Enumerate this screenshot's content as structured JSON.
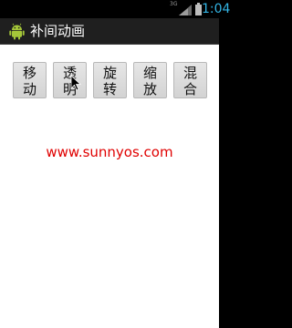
{
  "status_bar": {
    "network_label": "3G",
    "time": "1:04",
    "icons": [
      "signal-icon",
      "battery-icon"
    ],
    "time_color": "#33b5e5"
  },
  "title_bar": {
    "title": "补间动画",
    "icon": "android-icon"
  },
  "buttons": [
    {
      "line1": "移",
      "line2": "动"
    },
    {
      "line1": "透",
      "line2": "明"
    },
    {
      "line1": "旋",
      "line2": "转"
    },
    {
      "line1": "缩",
      "line2": "放"
    },
    {
      "line1": "混",
      "line2": "合"
    }
  ],
  "content": {
    "site_text": "www.sunnyos.com",
    "site_text_color": "#e00000"
  }
}
